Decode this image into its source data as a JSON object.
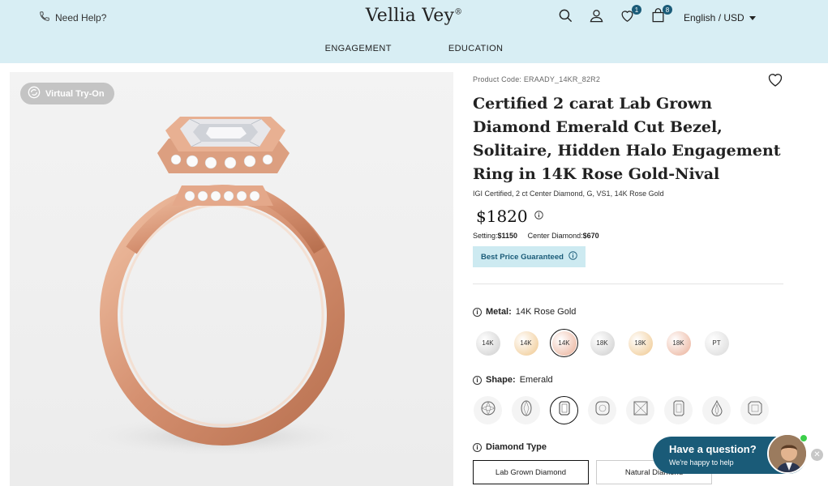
{
  "header": {
    "help_label": "Need Help?",
    "logo": "Vellia Vey",
    "logo_mark": "®",
    "wishlist_count": "1",
    "cart_count": "8",
    "language_currency": "English / USD"
  },
  "nav": {
    "items": [
      "ENGAGEMENT",
      "EDUCATION"
    ]
  },
  "gallery": {
    "try_on_label": "Virtual Try-On"
  },
  "product": {
    "code": "Product Code: ERAADY_14KR_82R2",
    "title": "Certified 2 carat Lab Grown Diamond Emerald Cut Bezel, Solitaire, Hidden Halo Engagement Ring in 14K Rose Gold-Nival",
    "subtitle": "IGI Certified, 2 ct Center Diamond, G, VS1, 14K Rose Gold",
    "price": "$1820",
    "setting_label": "Setting:",
    "setting_price": "$1150",
    "center_label": "Center Diamond:",
    "center_price": "$670",
    "best_price_label": "Best Price Guaranteed"
  },
  "metal": {
    "label": "Metal:",
    "value": "14K Rose Gold",
    "options": [
      {
        "label": "14K",
        "color": "#d9d9d9"
      },
      {
        "label": "14K",
        "color": "#f3d4a8"
      },
      {
        "label": "14K",
        "color": "#efc2b0",
        "selected": true
      },
      {
        "label": "18K",
        "color": "#d9d9d9"
      },
      {
        "label": "18K",
        "color": "#f3d4a8"
      },
      {
        "label": "18K",
        "color": "#efc2b0"
      },
      {
        "label": "PT",
        "color": "#e2e2e2"
      }
    ]
  },
  "shape": {
    "label": "Shape:",
    "value": "Emerald",
    "options": [
      "round-icon",
      "oval-icon",
      "emerald-icon",
      "cushion-icon",
      "princess-icon",
      "radiant-icon",
      "pear-icon",
      "asscher-icon"
    ]
  },
  "diamond_type": {
    "label": "Diamond Type",
    "options": [
      "Lab Grown Diamond",
      "Natural Diamond"
    ]
  },
  "chat": {
    "question": "Have a question?",
    "subtext": "We're happy to help"
  },
  "colors": {
    "header_bg": "#d8eef4",
    "accent": "#1a5b78",
    "rose_gold": "#d89a7d"
  }
}
